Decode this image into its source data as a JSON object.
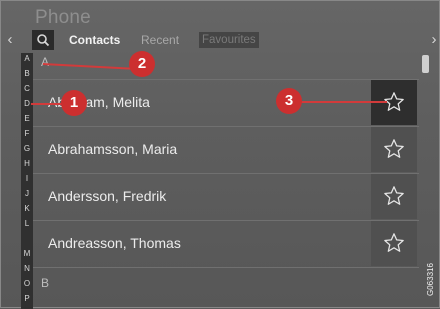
{
  "app": {
    "title": "Phone"
  },
  "nav": {
    "left_arrow": "‹",
    "right_arrow": "›"
  },
  "tabs": [
    {
      "label": "Contacts",
      "state": "active"
    },
    {
      "label": "Recent",
      "state": "inactive"
    },
    {
      "label": "Favourites",
      "state": "disabled"
    }
  ],
  "icons": {
    "search": "search-icon",
    "favourite": "star-outline-icon"
  },
  "alphabet": [
    "A",
    "B",
    "C",
    "D",
    "E",
    "F",
    "G",
    "H",
    "I",
    "J",
    "K",
    "L",
    "M",
    "N",
    "O",
    "P"
  ],
  "sections": [
    {
      "header": "A",
      "contacts": [
        {
          "name": "Abraham, Melita",
          "favourite_selected": true
        },
        {
          "name": "Abrahamsson, Maria",
          "favourite_selected": false
        },
        {
          "name": "Andersson, Fredrik",
          "favourite_selected": false
        },
        {
          "name": "Andreasson, Thomas",
          "favourite_selected": false
        }
      ]
    },
    {
      "header": "B",
      "contacts": []
    }
  ],
  "callouts": [
    {
      "number": "1"
    },
    {
      "number": "2"
    },
    {
      "number": "3"
    }
  ],
  "figure_code": "G063316",
  "colors": {
    "callout": "#cc2f2f",
    "highlight_cell": "#2e2e2e",
    "alphabet_bar": "#303030"
  }
}
